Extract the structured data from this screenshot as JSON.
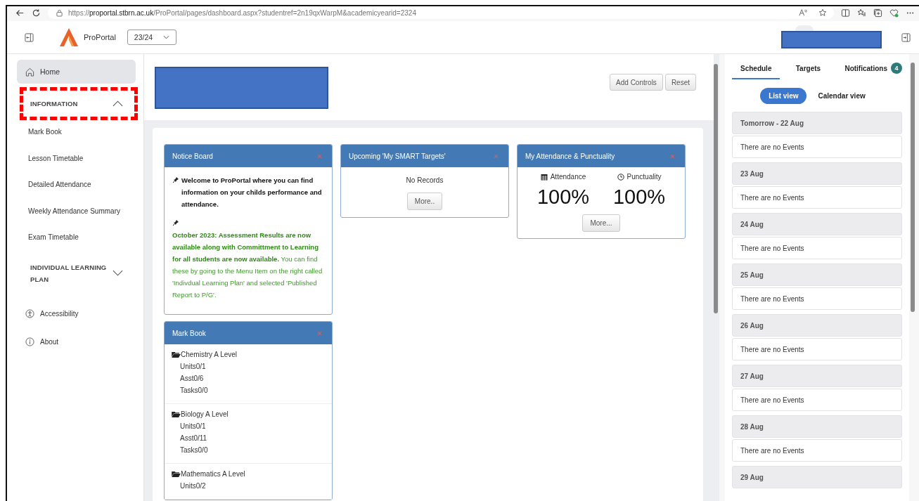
{
  "browser": {
    "url_scheme": "https://",
    "url_host": "proportal.stbrn.ac.uk",
    "url_path": "/ProPortal/pages/dashboard.aspx?studentref=2n19qxWarpM&academicyearid=2324"
  },
  "header": {
    "app_name": "ProPortal",
    "year": "23/24"
  },
  "sidebar": {
    "home": {
      "label": "Home",
      "selected": true
    },
    "sections": [
      {
        "label": "INFORMATION",
        "expanded": true,
        "highlighted": true,
        "children": [
          {
            "label": "Mark Book"
          },
          {
            "label": "Lesson Timetable"
          },
          {
            "label": "Detailed Attendance"
          },
          {
            "label": "Weekly Attendance Summary"
          },
          {
            "label": "Exam Timetable"
          }
        ]
      },
      {
        "label": "INDIVIDUAL LEARNING PLAN",
        "expanded": false,
        "highlighted": false
      }
    ],
    "links": [
      {
        "label": "Accessibility"
      },
      {
        "label": "About"
      }
    ]
  },
  "toolbar": {
    "buttons": [
      "Add Controls",
      "Reset"
    ]
  },
  "notice_board": {
    "title": "Notice Board",
    "notices": [
      {
        "kind": "plain",
        "text": "Welcome to ProPortal where you can find information on your childs performance and attendance."
      },
      {
        "kind": "green",
        "text": "**October 2023: Assessment Results are now available along with Committment to Learning for all students are now available.** You can find these by going to the Menu Item on the right called 'Indivdual Learning Plan' and selected 'Published Report to P/G'."
      }
    ]
  },
  "smart_targets": {
    "title": "Upcoming 'My SMART Targets'",
    "message": "No Records",
    "button": "More.."
  },
  "attendance": {
    "title": "My Attendance & Punctuality",
    "stats": [
      {
        "label": "Attendance",
        "value": "100%"
      },
      {
        "label": "Punctuality",
        "value": "100%"
      }
    ],
    "button": "More..."
  },
  "mark_book": {
    "title": "Mark Book",
    "subjects": [
      {
        "name": "Chemistry A Level",
        "lines": [
          "Units0/1",
          "Asst0/6",
          "Tasks0/0"
        ]
      },
      {
        "name": "Biology A Level",
        "lines": [
          "Units0/1",
          "Asst0/11",
          "Tasks0/0"
        ]
      },
      {
        "name": "Mathematics A Level",
        "lines": [
          "Units0/2"
        ]
      }
    ]
  },
  "right_panel": {
    "tabs": [
      {
        "label": "Schedule",
        "selected": true
      },
      {
        "label": "Targets",
        "selected": false
      },
      {
        "label": "Notifications",
        "selected": false,
        "badge": "4"
      }
    ],
    "views": [
      {
        "label": "List view",
        "selected": true
      },
      {
        "label": "Calendar view",
        "selected": false
      }
    ],
    "days": [
      {
        "date": "Tomorrow - 22 Aug",
        "events": "There are no Events"
      },
      {
        "date": "23 Aug",
        "events": "There are no Events"
      },
      {
        "date": "24 Aug",
        "events": "There are no Events"
      },
      {
        "date": "25 Aug",
        "events": "There are no Events"
      },
      {
        "date": "26 Aug",
        "events": "There are no Events"
      },
      {
        "date": "27 Aug",
        "events": "There are no Events"
      },
      {
        "date": "28 Aug",
        "events": "There are no Events"
      },
      {
        "date": "29 Aug"
      }
    ]
  }
}
